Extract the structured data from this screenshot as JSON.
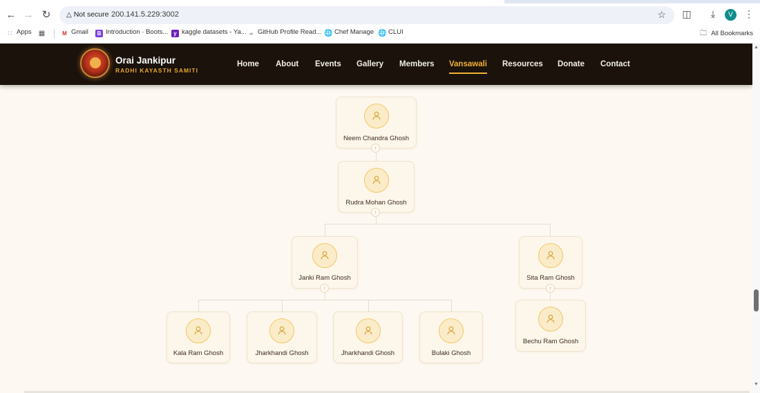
{
  "browser": {
    "security_label": "Not secure",
    "url": "200.141.5.229:3002",
    "avatar_letter": "V",
    "bookmarks": [
      {
        "label": "Apps"
      },
      {
        "label": "Gmail"
      },
      {
        "label": "Introduction · Boots..."
      },
      {
        "label": "kaggle datasets - Ya..."
      },
      {
        "label": "GitHub Profile Read..."
      },
      {
        "label": "Chef Manage"
      },
      {
        "label": "CLUI"
      }
    ],
    "all_bookmarks": "All Bookmarks"
  },
  "site": {
    "brand_title": "Orai Jankipur",
    "brand_subtitle": "RADHI KAYASTH SAMITI",
    "menu": [
      "Home",
      "About",
      "Events",
      "Gallery",
      "Members",
      "Vansawali",
      "Resources",
      "Donate",
      "Contact"
    ],
    "active_menu": "Vansawali",
    "accent_color": "#f0b232",
    "nav_bg_color": "#1a120b"
  },
  "family_tree": {
    "generation_1": [
      "Neem Chandra Ghosh"
    ],
    "generation_2": [
      "Rudra Mohan Ghosh"
    ],
    "generation_3": [
      "Janki Ram Ghosh",
      "Sita Ram Ghosh"
    ],
    "generation_4_janki": [
      "Kala Ram Ghosh",
      "Jharkhandi Ghosh",
      "Jharkhandi Ghosh",
      "Bulaki Ghosh"
    ],
    "generation_4_sita": [
      "Bechu Ram Ghosh"
    ]
  }
}
